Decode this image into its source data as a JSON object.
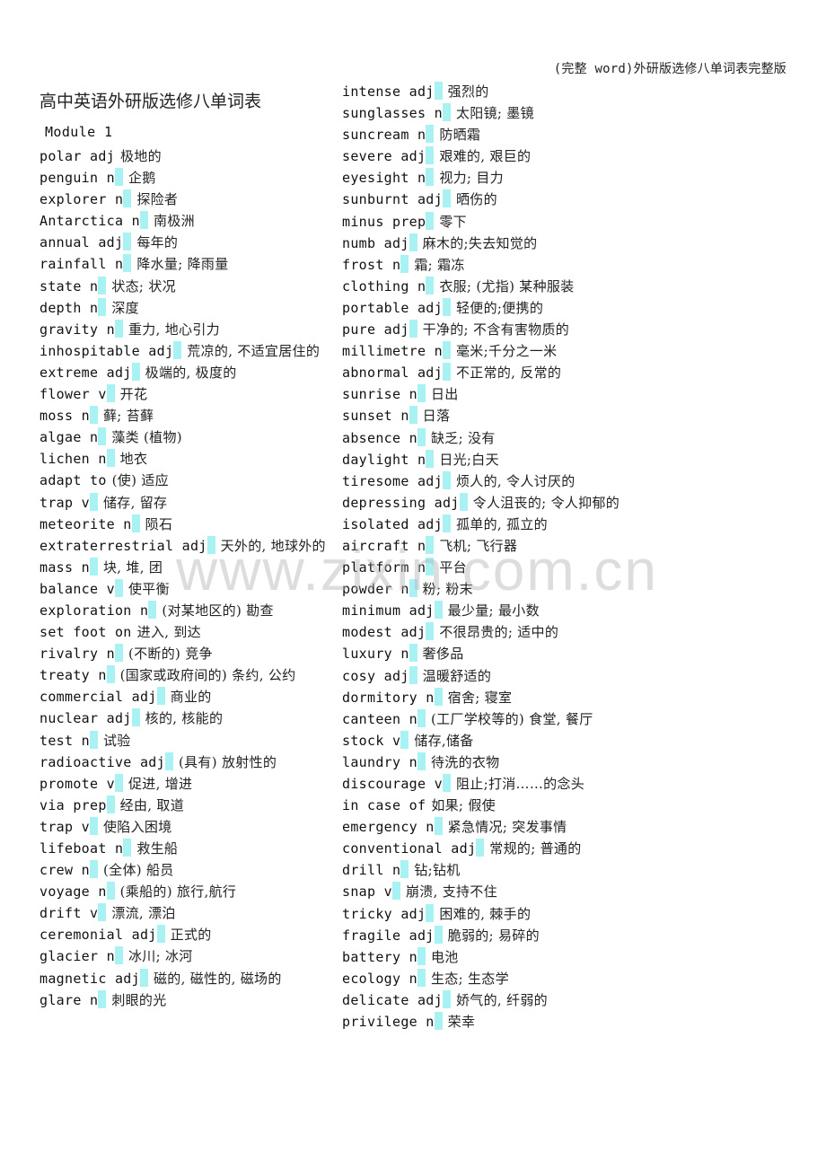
{
  "header_note": "(完整 word)外研版选修八单词表完整版",
  "title": "高中英语外研版选修八单词表",
  "module": "Module 1",
  "watermark": "www.zixin.com.cn",
  "highlight_color": "#a9f2f4",
  "left_column": [
    {
      "word": "polar adj",
      "hl": false,
      "cn": "极地的"
    },
    {
      "word": "penguin n",
      "hl": true,
      "cn": "企鹅"
    },
    {
      "word": "explorer n",
      "hl": true,
      "cn": "探险者"
    },
    {
      "word": "Antarctica n",
      "hl": true,
      "cn": "南极洲"
    },
    {
      "word": "annual adj",
      "hl": true,
      "cn": "每年的"
    },
    {
      "word": "rainfall n",
      "hl": true,
      "cn": "降水量; 降雨量"
    },
    {
      "word": "state n",
      "hl": true,
      "cn": "状态; 状况"
    },
    {
      "word": "depth n",
      "hl": true,
      "cn": "深度"
    },
    {
      "word": "gravity n",
      "hl": true,
      "cn": "重力, 地心引力"
    },
    {
      "word": "inhospitable adj",
      "hl": true,
      "cn": "荒凉的, 不适宜居住的"
    },
    {
      "word": "extreme adj",
      "hl": true,
      "cn": "极端的, 极度的"
    },
    {
      "word": "flower v",
      "hl": true,
      "cn": "开花"
    },
    {
      "word": "moss n",
      "hl": true,
      "cn": "藓; 苔藓"
    },
    {
      "word": "algae n",
      "hl": true,
      "cn": "藻类 (植物)"
    },
    {
      "word": "lichen n",
      "hl": true,
      "cn": "地衣"
    },
    {
      "word": "adapt to",
      "hl": false,
      "cn": "(使) 适应"
    },
    {
      "word": "trap v",
      "hl": true,
      "cn": "储存, 留存"
    },
    {
      "word": "meteorite n",
      "hl": true,
      "cn": "陨石"
    },
    {
      "word": "extraterrestrial adj",
      "hl": true,
      "cn": "天外的, 地球外的"
    },
    {
      "word": "mass n",
      "hl": true,
      "cn": "块, 堆, 团"
    },
    {
      "word": "balance v",
      "hl": true,
      "cn": "使平衡"
    },
    {
      "word": "exploration n",
      "hl": true,
      "cn": "(对某地区的) 勘查"
    },
    {
      "word": "set foot on",
      "hl": false,
      "cn": "进入, 到达"
    },
    {
      "word": "rivalry n",
      "hl": true,
      "cn": "(不断的) 竞争"
    },
    {
      "word": "treaty n",
      "hl": true,
      "cn": "(国家或政府间的) 条约, 公约"
    },
    {
      "word": "commercial adj",
      "hl": true,
      "cn": "商业的"
    },
    {
      "word": "nuclear adj",
      "hl": true,
      "cn": "核的, 核能的"
    },
    {
      "word": "test n",
      "hl": true,
      "cn": "试验"
    },
    {
      "word": "radioactive adj",
      "hl": true,
      "cn": "(具有) 放射性的"
    },
    {
      "word": "promote v",
      "hl": true,
      "cn": "促进, 增进"
    },
    {
      "word": "via prep",
      "hl": true,
      "cn": "经由, 取道"
    },
    {
      "word": "trap v",
      "hl": true,
      "cn": "使陷入困境"
    },
    {
      "word": "lifeboat n",
      "hl": true,
      "cn": "救生船"
    },
    {
      "word": "crew n",
      "hl": true,
      "cn": "(全体) 船员"
    },
    {
      "word": "voyage n",
      "hl": true,
      "cn": "(乘船的) 旅行,航行"
    },
    {
      "word": "drift v",
      "hl": true,
      "cn": "漂流, 漂泊"
    },
    {
      "word": "ceremonial adj",
      "hl": true,
      "cn": "正式的"
    },
    {
      "word": "glacier n",
      "hl": true,
      "cn": "冰川; 冰河"
    },
    {
      "word": "magnetic adj",
      "hl": true,
      "cn": "磁的, 磁性的, 磁场的"
    },
    {
      "word": "glare n",
      "hl": true,
      "cn": "刺眼的光"
    }
  ],
  "right_column": [
    {
      "word": "intense adj",
      "hl": true,
      "cn": "强烈的"
    },
    {
      "word": "sunglasses n",
      "hl": true,
      "cn": "太阳镜; 墨镜"
    },
    {
      "word": "suncream n",
      "hl": true,
      "cn": "防晒霜"
    },
    {
      "word": "severe adj",
      "hl": true,
      "cn": "艰难的, 艰巨的"
    },
    {
      "word": "eyesight n",
      "hl": true,
      "cn": "视力; 目力"
    },
    {
      "word": "sunburnt adj",
      "hl": true,
      "cn": "晒伤的"
    },
    {
      "word": "minus prep",
      "hl": true,
      "cn": "零下"
    },
    {
      "word": "numb adj",
      "hl": true,
      "cn": "麻木的;失去知觉的"
    },
    {
      "word": "frost n",
      "hl": true,
      "cn": "霜; 霜冻"
    },
    {
      "word": "clothing n",
      "hl": true,
      "cn": "衣服; (尤指) 某种服装"
    },
    {
      "word": "portable adj",
      "hl": true,
      "cn": "轻便的;便携的"
    },
    {
      "word": "pure adj",
      "hl": true,
      "cn": "干净的; 不含有害物质的"
    },
    {
      "word": "millimetre n",
      "hl": true,
      "cn": "毫米;千分之一米"
    },
    {
      "word": "abnormal adj",
      "hl": true,
      "cn": "不正常的, 反常的"
    },
    {
      "word": "sunrise n",
      "hl": true,
      "cn": "日出"
    },
    {
      "word": "sunset n",
      "hl": true,
      "cn": "日落"
    },
    {
      "word": "absence n",
      "hl": true,
      "cn": "缺乏; 没有"
    },
    {
      "word": "daylight n",
      "hl": true,
      "cn": "日光;白天"
    },
    {
      "word": "tiresome adj",
      "hl": true,
      "cn": "烦人的, 令人讨厌的"
    },
    {
      "word": "depressing adj",
      "hl": true,
      "cn": "令人沮丧的; 令人抑郁的"
    },
    {
      "word": "isolated adj",
      "hl": true,
      "cn": "孤单的, 孤立的"
    },
    {
      "word": "aircraft n",
      "hl": true,
      "cn": "飞机; 飞行器"
    },
    {
      "word": "platform n",
      "hl": true,
      "cn": "平台"
    },
    {
      "word": "powder n",
      "hl": true,
      "cn": "粉; 粉末"
    },
    {
      "word": "minimum adj",
      "hl": true,
      "cn": "最少量; 最小数"
    },
    {
      "word": "modest adj",
      "hl": true,
      "cn": "不很昂贵的; 适中的"
    },
    {
      "word": "luxury n",
      "hl": true,
      "cn": "奢侈品"
    },
    {
      "word": "cosy adj",
      "hl": true,
      "cn": "温暖舒适的"
    },
    {
      "word": "dormitory n",
      "hl": true,
      "cn": "宿舍; 寝室"
    },
    {
      "word": "canteen n",
      "hl": true,
      "cn": "(工厂学校等的) 食堂, 餐厅"
    },
    {
      "word": "stock v",
      "hl": true,
      "cn": "储存,储备"
    },
    {
      "word": "laundry n",
      "hl": true,
      "cn": "待洗的衣物"
    },
    {
      "word": "discourage v",
      "hl": true,
      "cn": "阻止;打消……的念头"
    },
    {
      "word": "in case of",
      "hl": false,
      "cn": "如果; 假使"
    },
    {
      "word": "emergency n",
      "hl": true,
      "cn": "紧急情况; 突发事情"
    },
    {
      "word": "conventional adj",
      "hl": true,
      "cn": "常规的; 普通的"
    },
    {
      "word": "drill n",
      "hl": true,
      "cn": "钻;钻机"
    },
    {
      "word": "snap v",
      "hl": true,
      "cn": "崩溃, 支持不住"
    },
    {
      "word": "tricky adj",
      "hl": true,
      "cn": "困难的, 棘手的"
    },
    {
      "word": "fragile adj",
      "hl": true,
      "cn": "脆弱的; 易碎的"
    },
    {
      "word": "battery n",
      "hl": true,
      "cn": "电池"
    },
    {
      "word": "ecology n",
      "hl": true,
      "cn": "生态; 生态学"
    },
    {
      "word": "delicate adj",
      "hl": true,
      "cn": "娇气的, 纤弱的"
    },
    {
      "word": "privilege n",
      "hl": true,
      "cn": "荣幸"
    }
  ]
}
